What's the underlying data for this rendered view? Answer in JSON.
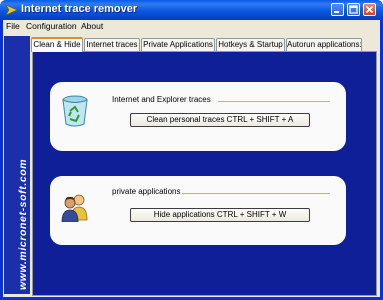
{
  "window": {
    "title": "Internet trace remover"
  },
  "menu": [
    {
      "label": "File"
    },
    {
      "label": "Configuration"
    },
    {
      "label": "About"
    }
  ],
  "sidebar": {
    "text": "www.micronet-soft.com"
  },
  "tabs": [
    {
      "label": "Clean & Hide",
      "active": true
    },
    {
      "label": "Internet traces",
      "active": false
    },
    {
      "label": "Private Applications",
      "active": false
    },
    {
      "label": "Hotkeys & Startup",
      "active": false
    },
    {
      "label": "Autorun applications:",
      "active": false
    }
  ],
  "groups": {
    "traces": {
      "label": "Internet and Explorer traces",
      "button": "Clean personal traces  CTRL + SHIFT + A",
      "icon": "recycle-bin-icon"
    },
    "apps": {
      "label": "private applications",
      "button": "Hide applications  CTRL + SHIFT + W",
      "icon": "users-icon"
    }
  },
  "colors": {
    "titlebar": "#0a5ae8",
    "sidebar": "#1a2fa8",
    "panel": "#0e1f98",
    "face": "#ece9d8",
    "tab_highlight": "#e68b2c"
  }
}
